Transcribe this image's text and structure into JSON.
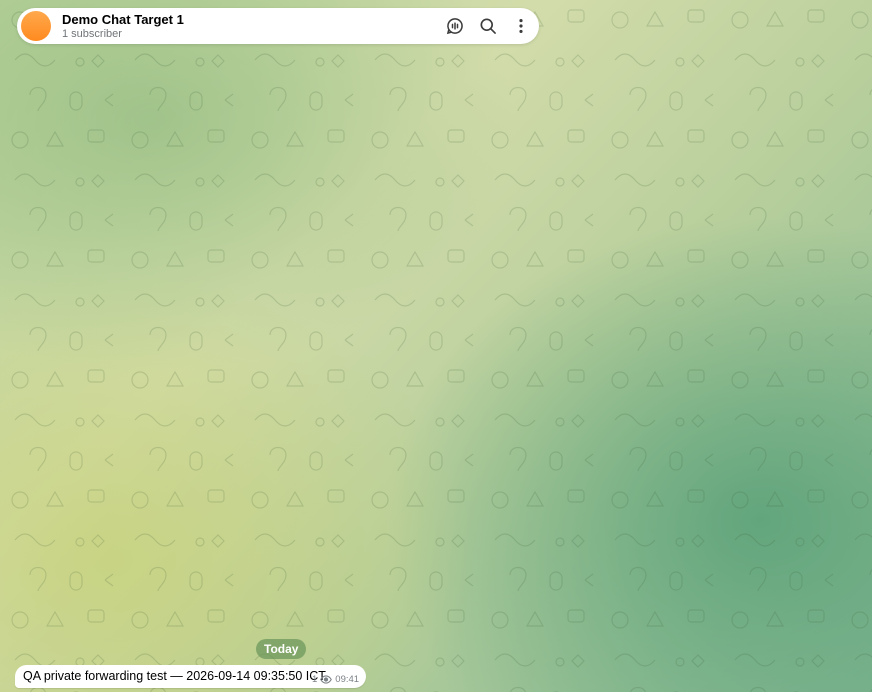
{
  "header": {
    "title": "Demo Chat Target 1",
    "subtitle": "1 subscriber",
    "avatar_color": "#ff9a2e",
    "icons": [
      "voice-chat-icon",
      "search-icon",
      "more-vertical-icon"
    ]
  },
  "chat": {
    "date_separator": "Today",
    "messages": [
      {
        "text": "QA private forwarding test — 2026-09-14 09:35:50 ICT",
        "views": "1",
        "time": "09:41"
      }
    ]
  }
}
